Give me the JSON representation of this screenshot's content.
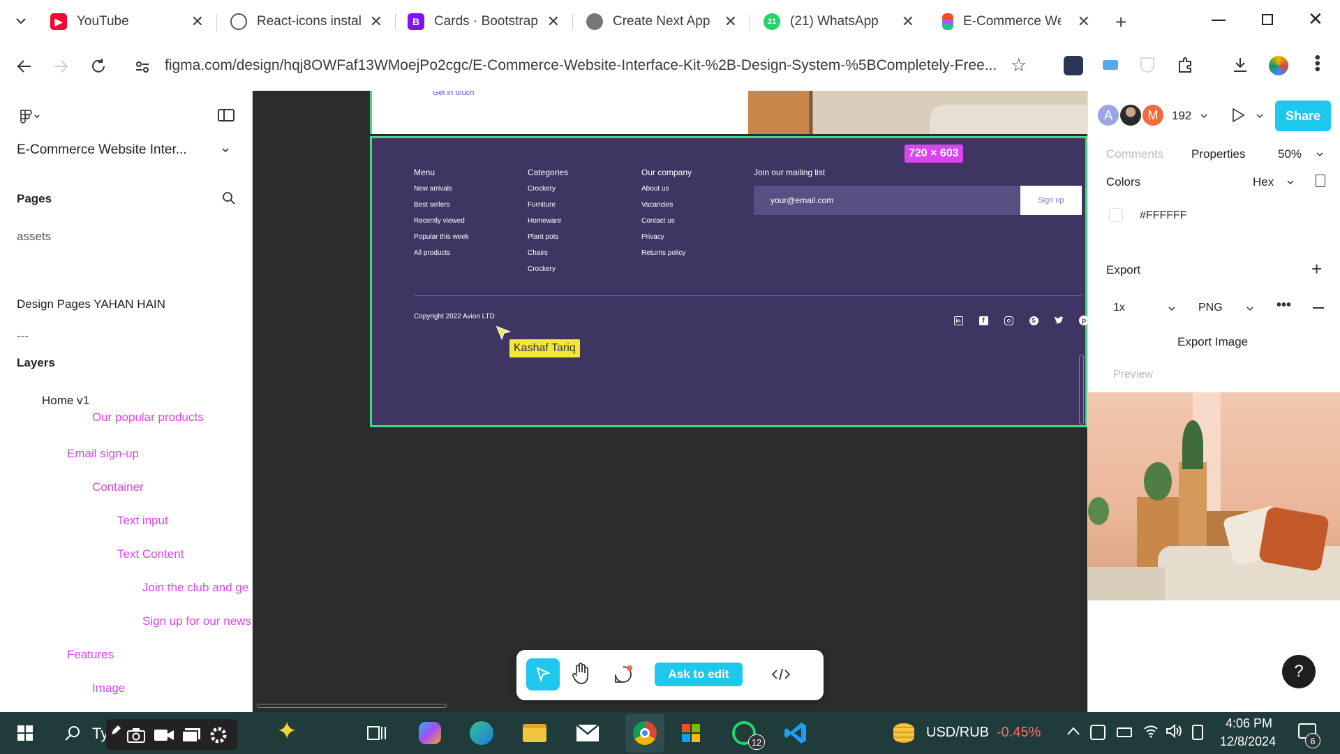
{
  "browser": {
    "tabs": [
      {
        "title": "YouTube",
        "icon": "youtube-icon",
        "color": "#ff0033"
      },
      {
        "title": "React-icons instal",
        "icon": "chatgpt-icon",
        "color": "#555555"
      },
      {
        "title": "Cards · Bootstrap",
        "icon": "bootstrap-icon",
        "color": "#7f12f6"
      },
      {
        "title": "Create Next App",
        "icon": "globe-icon",
        "color": "#666666"
      },
      {
        "title": "(21) WhatsApp",
        "icon": "whatsapp-icon",
        "color": "#25d366"
      },
      {
        "title": "E-Commerce Wel",
        "icon": "figma-icon",
        "color": "#f24e1e"
      }
    ],
    "url": "figma.com/design/hqj8OWFaf13WMoejPo2cgc/E-Commerce-Website-Interface-Kit-%2B-Design-System-%5BCompletely-Free..."
  },
  "figma": {
    "file_name": "E-Commerce Website Inter...",
    "pages_label": "Pages",
    "pages": [
      "assets",
      "Design Pages YAHAN HAIN",
      "---"
    ],
    "layers_label": "Layers",
    "layers": [
      {
        "name": "Home v1",
        "color": "#222222"
      },
      {
        "name": "Our popular products",
        "color": "#d946ef"
      },
      {
        "name": "Email sign-up",
        "color": "#d946ef"
      },
      {
        "name": "Container",
        "color": "#d946ef"
      },
      {
        "name": "Text input",
        "color": "#d946ef"
      },
      {
        "name": "Text Content",
        "color": "#d946ef"
      },
      {
        "name": "Join the club and ge",
        "color": "#d946ef"
      },
      {
        "name": "Sign up for our news",
        "color": "#d946ef"
      },
      {
        "name": "Features",
        "color": "#d946ef"
      },
      {
        "name": "Image",
        "color": "#d946ef"
      }
    ]
  },
  "canvas": {
    "get_in_touch": "Get in touch",
    "size_badge": "720 × 603",
    "footer": {
      "menu": {
        "heading": "Menu",
        "items": [
          "New arrivals",
          "Best sellers",
          "Recently viewed",
          "Popular this week",
          "All products"
        ]
      },
      "categories": {
        "heading": "Categories",
        "items": [
          "Crockery",
          "Furniture",
          "Homeware",
          "Plant pots",
          "Chairs",
          "Crockery"
        ]
      },
      "company": {
        "heading": "Our company",
        "items": [
          "About us",
          "Vacancies",
          "Contact us",
          "Privacy",
          "Returns policy"
        ]
      },
      "mailing": {
        "heading": "Join our mailing list",
        "placeholder": "your@email.com",
        "button": "Sign up"
      },
      "copyright": "Copyright 2022 Avion LTD",
      "socials": [
        "linkedin-icon",
        "facebook-icon",
        "instagram-icon",
        "skype-icon",
        "twitter-icon",
        "pinterest-icon"
      ]
    },
    "cursor_label": "Kashaf Tariq"
  },
  "toolbar": {
    "ask_to_edit": "Ask to edit"
  },
  "right_panel": {
    "avatars": [
      {
        "letter": "A",
        "color": "#9aa6e8"
      },
      {
        "letter": "M",
        "color": "#f26b3a"
      }
    ],
    "viewer_count": "192",
    "share": "Share",
    "tabs": {
      "comments": "Comments",
      "properties": "Properties",
      "zoom": "50%"
    },
    "colors_label": "Colors",
    "color_format": "Hex",
    "color_value": "#FFFFFF",
    "export_label": "Export",
    "export_scale": "1x",
    "export_format": "PNG",
    "export_button": "Export Image",
    "preview_label": "Preview"
  },
  "taskbar": {
    "search_text": "Ty",
    "ticker": "USD/RUB",
    "ticker_change": "-0.45%",
    "time": "4:06 PM",
    "date": "12/8/2024",
    "whatsapp_badge": "12",
    "notif_badge": "6"
  }
}
